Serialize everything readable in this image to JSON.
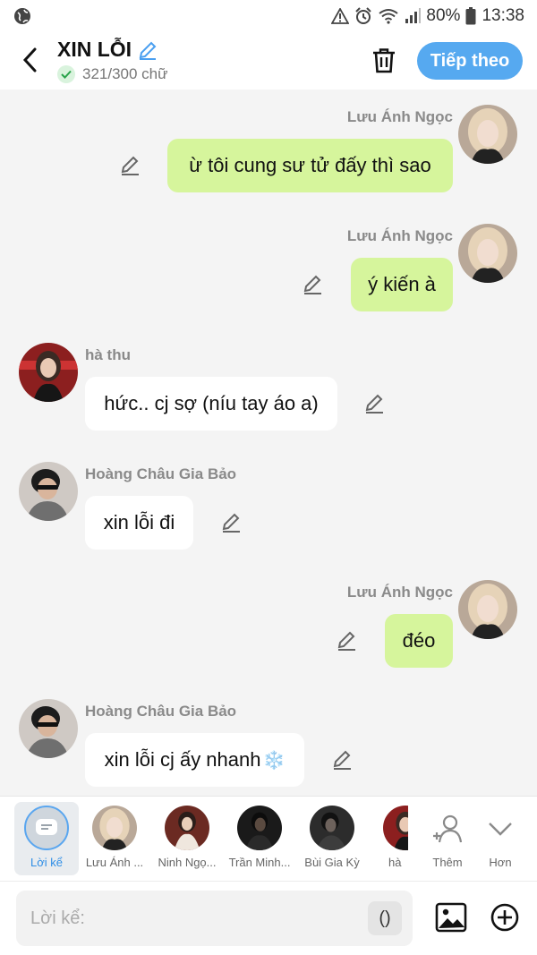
{
  "status": {
    "battery": "80%",
    "time": "13:38"
  },
  "header": {
    "title": "XIN LỖI",
    "counter": "321/300 chữ",
    "next_label": "Tiếp theo"
  },
  "messages": [
    {
      "sender": "Lưu Ánh Ngọc",
      "text": "ừ tôi cung sư tử đấy thì sao",
      "side": "right"
    },
    {
      "sender": "Lưu Ánh Ngọc",
      "text": "ý kiến à",
      "side": "right"
    },
    {
      "sender": "hà thu",
      "text": "hức.. cj sợ (níu tay áo a)",
      "side": "left"
    },
    {
      "sender": "Hoàng Châu Gia Bảo",
      "text": "xin lỗi đi",
      "side": "left"
    },
    {
      "sender": "Lưu Ánh Ngọc",
      "text": "đéo",
      "side": "right"
    },
    {
      "sender": "Hoàng Châu Gia Bảo",
      "text": "xin lỗi cj ấy nhanh",
      "side": "left",
      "emoji": "❄️"
    }
  ],
  "characters": [
    {
      "label": "Lời kể"
    },
    {
      "label": "Lưu Ánh ..."
    },
    {
      "label": "Ninh Ngọ..."
    },
    {
      "label": "Trần Minh..."
    },
    {
      "label": "Bùi Gia Kỳ"
    },
    {
      "label": "hà"
    }
  ],
  "actions": {
    "add_label": "Thêm",
    "more_label": "Hơn"
  },
  "input": {
    "placeholder": "Lời kể:",
    "paren": "()"
  },
  "colors": {
    "accent": "#56a9f0",
    "my_bubble": "#d6f59c",
    "other_bubble": "#ffffff"
  }
}
